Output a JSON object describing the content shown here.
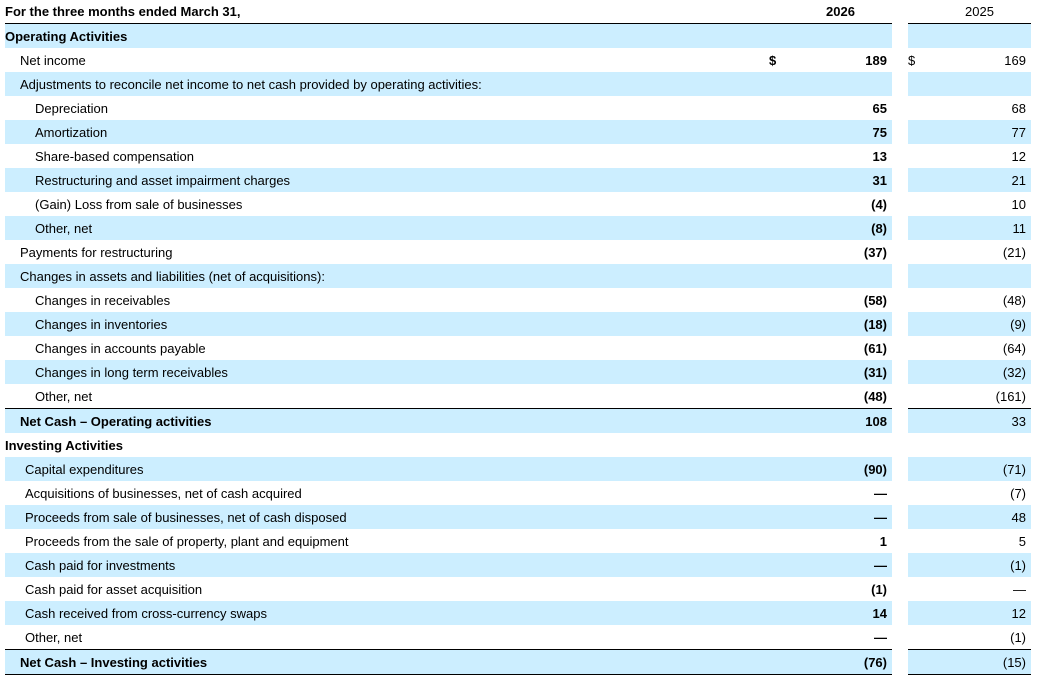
{
  "header": {
    "period_label": "For the three months ended March 31,",
    "year_current": "2026",
    "year_prior": "2025"
  },
  "colors": {
    "row_shade": "#cceeff",
    "text": "#000000"
  },
  "currency_symbol": "$",
  "rows": [
    {
      "label": "Operating Activities",
      "type": "section",
      "v1": "",
      "v2": ""
    },
    {
      "label": "Net income",
      "type": "item1",
      "v1": "189",
      "v2": "169",
      "dollar": true
    },
    {
      "label": "Adjustments to reconcile net income to net cash provided by operating activities:",
      "type": "item1",
      "v1": "",
      "v2": ""
    },
    {
      "label": "Depreciation",
      "type": "item2",
      "v1": "65",
      "v2": "68"
    },
    {
      "label": "Amortization",
      "type": "item2",
      "v1": "75",
      "v2": "77"
    },
    {
      "label": "Share-based compensation",
      "type": "item2",
      "v1": "13",
      "v2": "12"
    },
    {
      "label": "Restructuring and asset impairment charges",
      "type": "item2",
      "v1": "31",
      "v2": "21"
    },
    {
      "label": "(Gain) Loss from sale of businesses",
      "type": "item2",
      "v1": "(4)",
      "v2": "10"
    },
    {
      "label": "Other, net",
      "type": "item2",
      "v1": "(8)",
      "v2": "11"
    },
    {
      "label": "Payments for restructuring",
      "type": "item1",
      "v1": "(37)",
      "v2": "(21)"
    },
    {
      "label": "Changes in assets and liabilities (net of acquisitions):",
      "type": "item1",
      "v1": "",
      "v2": ""
    },
    {
      "label": "Changes in receivables",
      "type": "item2",
      "v1": "(58)",
      "v2": "(48)"
    },
    {
      "label": "Changes in inventories",
      "type": "item2",
      "v1": "(18)",
      "v2": "(9)"
    },
    {
      "label": "Changes in accounts payable",
      "type": "item2",
      "v1": "(61)",
      "v2": "(64)"
    },
    {
      "label": "Changes in long term receivables",
      "type": "item2",
      "v1": "(31)",
      "v2": "(32)"
    },
    {
      "label": "Other, net",
      "type": "item2",
      "v1": "(48)",
      "v2": "(161)"
    },
    {
      "label": "Net Cash – Operating activities",
      "type": "total",
      "v1": "108",
      "v2": "33"
    },
    {
      "label": "Investing Activities",
      "type": "section",
      "v1": "",
      "v2": ""
    },
    {
      "label": "Capital expenditures",
      "type": "item3",
      "v1": "(90)",
      "v2": "(71)"
    },
    {
      "label": "Acquisitions of businesses, net of cash acquired",
      "type": "item3",
      "v1": "—",
      "v2": "(7)"
    },
    {
      "label": "Proceeds from sale of businesses, net of cash disposed",
      "type": "item3",
      "v1": "—",
      "v2": "48"
    },
    {
      "label": "Proceeds from the sale of property, plant and equipment",
      "type": "item3",
      "v1": "1",
      "v2": "5"
    },
    {
      "label": "Cash paid for investments",
      "type": "item3",
      "v1": "—",
      "v2": "(1)"
    },
    {
      "label": "Cash paid for asset acquisition",
      "type": "item3",
      "v1": "(1)",
      "v2": "—"
    },
    {
      "label": "Cash received from cross-currency swaps",
      "type": "item3",
      "v1": "14",
      "v2": "12"
    },
    {
      "label": "Other, net",
      "type": "item3",
      "v1": "—",
      "v2": "(1)"
    },
    {
      "label": "Net Cash – Investing activities",
      "type": "total",
      "v1": "(76)",
      "v2": "(15)"
    }
  ]
}
